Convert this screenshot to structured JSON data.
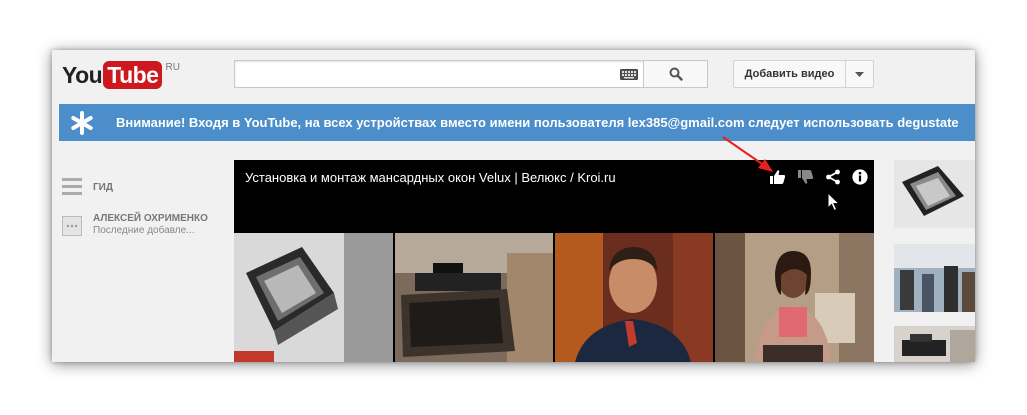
{
  "masthead": {
    "logo_you": "You",
    "logo_tube": "Tube",
    "logo_region": "RU",
    "search_value": "",
    "upload_label": "Добавить видео"
  },
  "banner": {
    "text": "Внимание! Входя в YouTube, на всех устройствах вместо имени пользователя lex385@gmail.com следует использовать degustate"
  },
  "sidebar": {
    "guide_label": "ГИД",
    "channel_name": "АЛЕКСЕЙ ОХРИМЕНКО",
    "channel_sub": "Последние добавле..."
  },
  "player": {
    "title": "Установка и монтаж мансардных окон Velux | Велюкс / Kroi.ru",
    "icons": [
      "like-icon",
      "dislike-icon",
      "share-icon",
      "info-icon"
    ]
  },
  "colors": {
    "banner": "#4c8ec9",
    "logo_red": "#cc181e",
    "annotation_arrow": "#e8201c"
  }
}
